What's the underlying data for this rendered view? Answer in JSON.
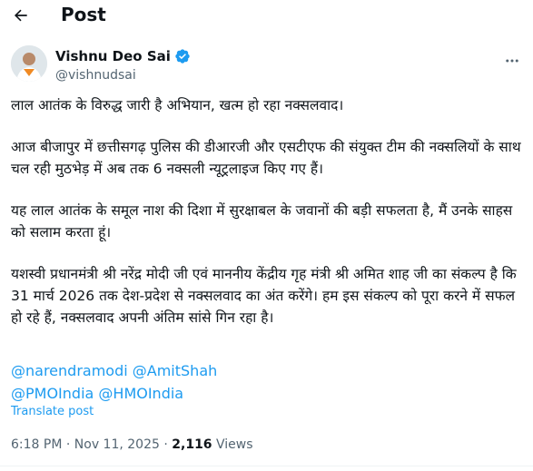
{
  "header": {
    "back_icon": "arrow-left-icon",
    "title": "Post"
  },
  "author": {
    "display_name": "Vishnu Deo Sai",
    "handle": "@vishnudsai",
    "verified_icon": "verified-badge-icon",
    "verified_color": "#1d9bf0",
    "more_icon": "more-horizontal-icon"
  },
  "tweet": {
    "paragraphs": [
      "लाल आतंक के विरुद्ध जारी है अभियान, खत्म हो रहा नक्सलवाद।",
      "आज बीजापुर में छत्तीसगढ़ पुलिस की डीआरजी और एसटीएफ की संयुक्त टीम की नक्सलियों के साथ चल रही मुठभेड़ में अब तक 6 नक्सली न्यूट्रलाइज किए गए हैं।",
      "यह लाल आतंक के समूल नाश की दिशा में सुरक्षाबल के जवानों की बड़ी सफलता है, मैं उनके साहस को सलाम करता हूं।",
      "यशस्वी प्रधानमंत्री श्री नरेंद्र मोदी जी एवं माननीय केंद्रीय गृह मंत्री श्री अमित शाह जी का संकल्प है कि 31 मार्च 2026 तक देश-प्रदेश से नक्सलवाद का अंत करेंगे। हम इस संकल्प को पूरा करने में सफल हो रहे हैं, नक्सलवाद अपनी अंतिम सांसे गिन रहा है।"
    ],
    "mentions": [
      "@narendramodi",
      "@AmitShah",
      "@PMOIndia",
      "@HMOIndia"
    ],
    "translate_label": "Translate post"
  },
  "meta": {
    "time": "6:18 PM",
    "separator": " · ",
    "date": "Nov 11, 2025",
    "views_count": "2,116",
    "views_label": " Views"
  },
  "colors": {
    "link": "#1d9bf0",
    "secondary_text": "#536471",
    "primary_text": "#0f1419"
  }
}
